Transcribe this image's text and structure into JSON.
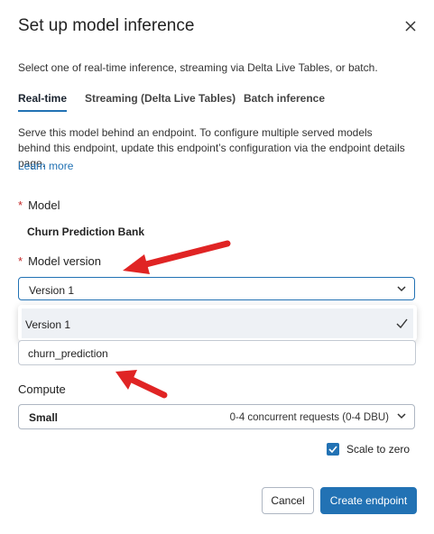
{
  "dialog": {
    "title": "Set up model inference",
    "subtitle": "Select one of real-time inference, streaming via Delta Live Tables, or batch.",
    "tabs": [
      {
        "label": "Real-time",
        "active": true
      },
      {
        "label": "Streaming (Delta Live Tables)",
        "active": false
      },
      {
        "label": "Batch inference",
        "active": false
      }
    ],
    "description": "Serve this model behind an endpoint. To configure multiple served models behind this endpoint, update this endpoint’s configuration via the endpoint details page.",
    "learn_more": "Learn more"
  },
  "form": {
    "required_mark": "*",
    "model_label": "Model",
    "model_name": "Churn Prediction Bank",
    "version_label": "Model version",
    "version_value": "Version 1",
    "version_options": [
      {
        "label": "Version 1",
        "selected": true
      }
    ],
    "endpoint_name_value": "churn_prediction",
    "compute_label": "Compute",
    "compute_value": "Small",
    "compute_detail": "0-4 concurrent requests (0-4 DBU)",
    "scale_to_zero_label": "Scale to zero",
    "scale_to_zero_checked": true
  },
  "footer": {
    "cancel_label": "Cancel",
    "create_label": "Create endpoint"
  },
  "colors": {
    "accent": "#2272b4",
    "annotation_arrow": "#e02424",
    "required": "#c42a2a"
  },
  "icons": [
    "close-icon",
    "chevron-down-icon",
    "checkmark-icon",
    "checkbox-check-icon"
  ]
}
